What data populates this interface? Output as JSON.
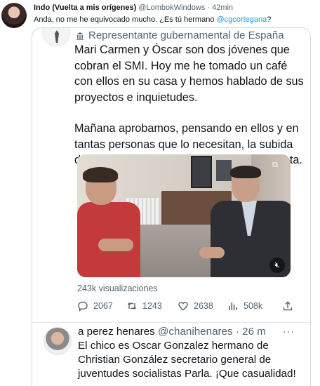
{
  "outer_tweet": {
    "display_name": "Indo (Vuelta a mis orígenes)",
    "handle": "@LombokWindows",
    "separator": "·",
    "time": "42min",
    "text_before_mention": "Anda, no me he equivocado mucho. ¿Es tú hermano ",
    "mention": "@cgcortegana",
    "text_after_mention": "?"
  },
  "quoted_screenshot": {
    "role_label": "Representante gubernamental de España",
    "paragraph_1": "Mari Carmen y Óscar son dos jóvenes que cobran el SMI. Hoy me he tomado un café con ellos en su casa y hemos hablado de sus proyectos e inquietudes.",
    "paragraph_2": "Mañana aprobamos, pensando en ellos y en tantas personas que lo necesitan, la subida del SMI a 1.080 euros. Es una decisión justa.",
    "views": "243k visualizaciones",
    "actions": {
      "replies": "2067",
      "retweets": "1243",
      "likes": "2638",
      "analytics": "508k"
    },
    "reply": {
      "display_name": "a perez henares",
      "handle": "@chanihenares",
      "separator": "·",
      "time": "26 m",
      "text": "El chico es Oscar Gonzalez hermano de Christian González secretario general de juventudes socialistas Parla. ¡Que casualidad!"
    }
  },
  "colors": {
    "accent": "#1d9bf0",
    "text": "#0f1419",
    "muted": "#536471",
    "border": "#cfd9de"
  }
}
